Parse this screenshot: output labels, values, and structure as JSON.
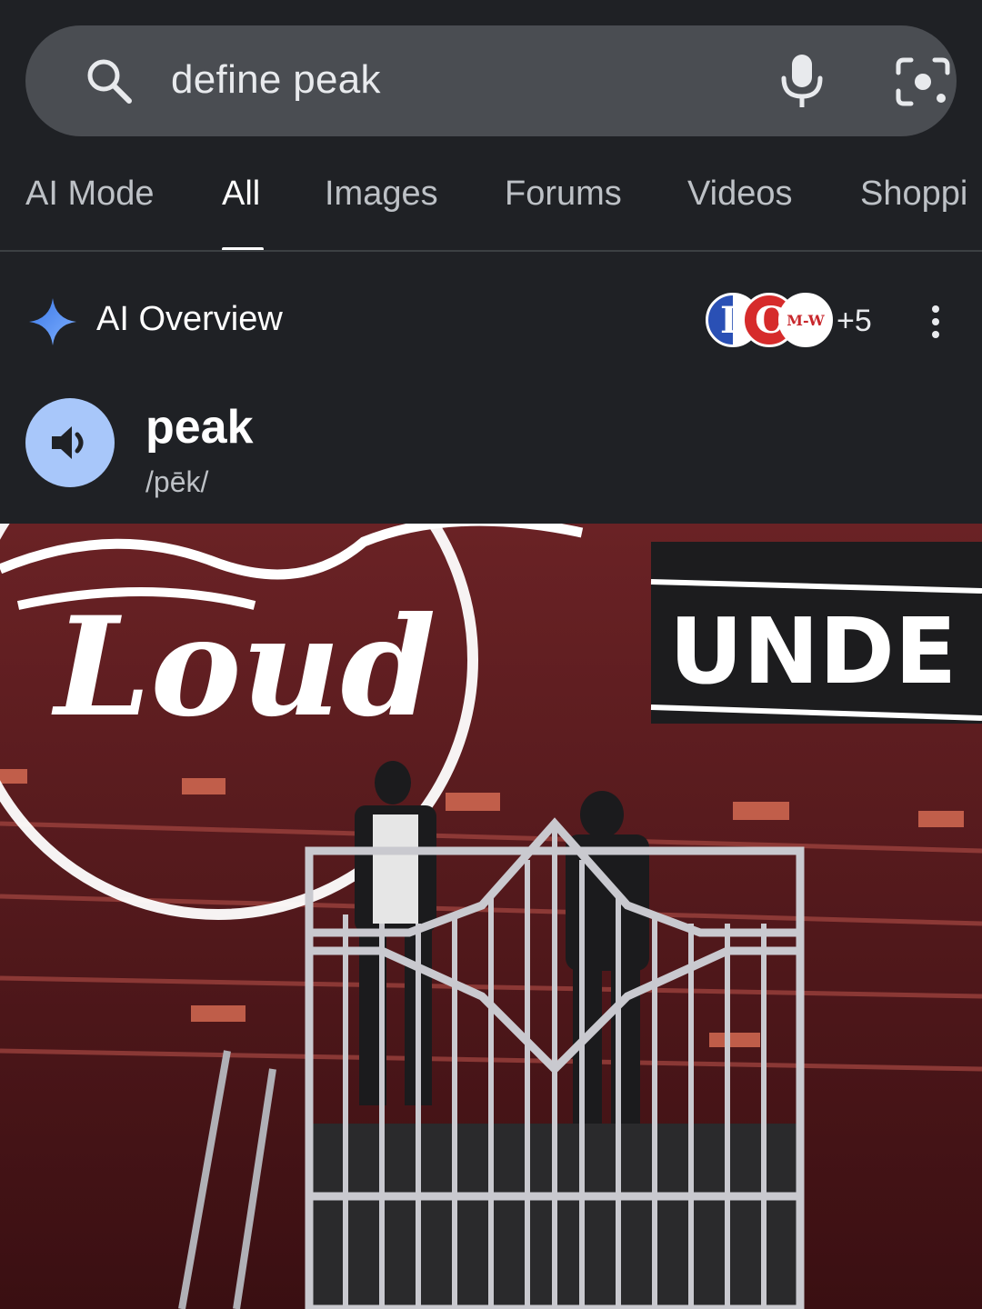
{
  "search": {
    "query": "define peak"
  },
  "tabs": [
    {
      "label": "AI Mode"
    },
    {
      "label": "All",
      "active": true
    },
    {
      "label": "Images"
    },
    {
      "label": "Forums"
    },
    {
      "label": "Videos"
    },
    {
      "label": "Shoppi"
    }
  ],
  "ai_overview": {
    "title": "AI Overview",
    "sources": [
      {
        "letter": "L"
      },
      {
        "letter": "C"
      },
      {
        "letter": "M-W"
      }
    ],
    "more_sources": "+5"
  },
  "definition": {
    "word": "peak",
    "pronunciation": "/pēk/"
  },
  "video": {
    "sign_text": "Loud",
    "screen_text": "UNDE"
  },
  "colors": {
    "background": "#1f2125",
    "search_bar": "#4a4d52",
    "speaker_button": "#a8c7fa",
    "sparkle_blue": "#4c8df6"
  }
}
